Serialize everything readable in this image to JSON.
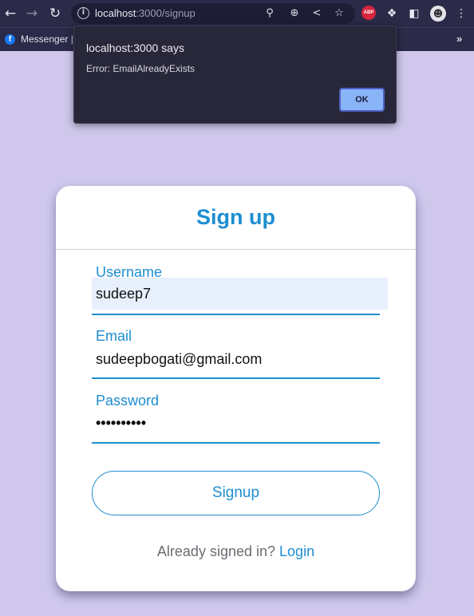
{
  "browser": {
    "url_host": "localhost",
    "url_path": ":3000/signup",
    "bookmark_label": "Messenger |",
    "bookmarks_overflow": "»"
  },
  "icons": {
    "back": "arrow-left",
    "forward": "arrow-right",
    "reload": "reload",
    "info": "info",
    "key": "key",
    "zoom": "zoom",
    "share": "share",
    "star": "star",
    "adblock": "ABP",
    "extensions": "puzzle",
    "sidepanel": "sidepanel",
    "profile": "avatar",
    "menu": "kebab"
  },
  "alert": {
    "title": "localhost:3000 says",
    "message": "Error: EmailAlreadyExists",
    "ok_label": "OK"
  },
  "form": {
    "title": "Sign up",
    "username_label": "Username",
    "username_value": "sudeep7",
    "email_label": "Email",
    "email_value": "sudeepbogati@gmail.com",
    "password_label": "Password",
    "password_value": "••••••••••",
    "submit_label": "Signup",
    "login_prompt": "Already signed in?",
    "login_link": "Login"
  },
  "colors": {
    "accent": "#1d8ed1",
    "page_background": "#cfc8ec",
    "browser_chrome": "#2b2a48",
    "dialog_button": "#8ab4f8"
  }
}
